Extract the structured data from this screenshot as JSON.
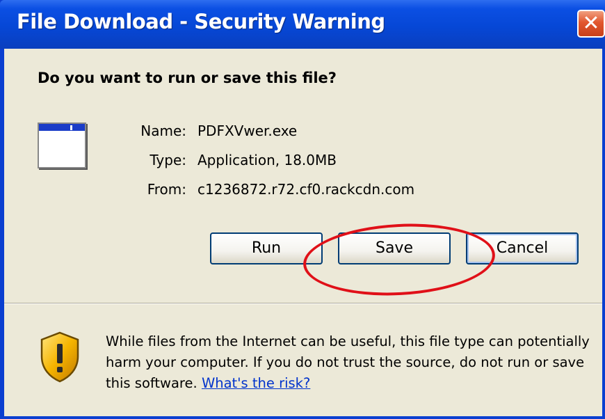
{
  "window": {
    "title": "File Download - Security Warning",
    "close_glyph": "✕"
  },
  "dialog": {
    "question": "Do you want to run or save this file?",
    "file_icon": "application-window-icon",
    "fields": [
      {
        "label": "Name:",
        "value": "PDFXVwer.exe"
      },
      {
        "label": "Type:",
        "value": "Application, 18.0MB"
      },
      {
        "label": "From:",
        "value": "c1236872.r72.cf0.rackcdn.com"
      }
    ],
    "buttons": {
      "run": "Run",
      "save": "Save",
      "cancel": "Cancel"
    }
  },
  "warning": {
    "icon": "shield-warning-icon",
    "text": "While files from the Internet can be useful, this file type can potentially harm your computer. If you do not trust the source, do not run or save this software.",
    "link": "What's the risk?"
  },
  "colors": {
    "titlebar": "#0647d6",
    "dialog_bg": "#ece9d8",
    "highlight_ring": "#e01018",
    "link": "#0033cc"
  }
}
